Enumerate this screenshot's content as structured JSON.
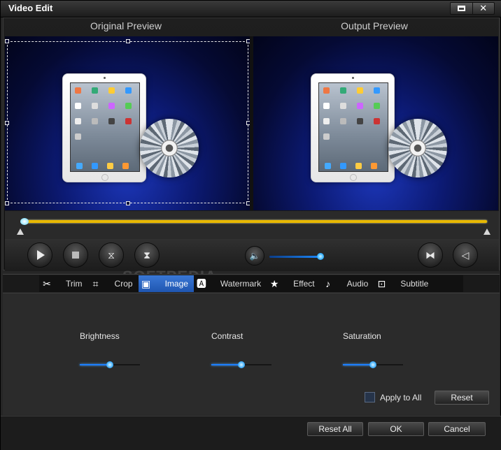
{
  "window": {
    "title": "Video Edit"
  },
  "preview": {
    "original_label": "Original Preview",
    "output_label": "Output Preview"
  },
  "timeline": {
    "position": 0.0
  },
  "volume": {
    "level": 0.9
  },
  "tabs": [
    {
      "label": "Trim",
      "icon": "scissors-icon"
    },
    {
      "label": "Crop",
      "icon": "crop-icon"
    },
    {
      "label": "Image",
      "icon": "image-icon",
      "active": true
    },
    {
      "label": "Watermark",
      "icon": "watermark-icon"
    },
    {
      "label": "Effect",
      "icon": "star-icon"
    },
    {
      "label": "Audio",
      "icon": "music-note-icon"
    },
    {
      "label": "Subtitle",
      "icon": "subtitle-icon"
    }
  ],
  "image": {
    "brightness": {
      "label": "Brightness",
      "value": 0.5
    },
    "contrast": {
      "label": "Contrast",
      "value": 0.5
    },
    "saturation": {
      "label": "Saturation",
      "value": 0.5
    },
    "apply_to_all": {
      "label": "Apply to All",
      "checked": false
    },
    "reset_label": "Reset"
  },
  "footer": {
    "reset_all": "Reset All",
    "ok": "OK",
    "cancel": "Cancel"
  },
  "watermark_text": "SOFTPEDIA",
  "colors": {
    "accent": "#1f56b0",
    "timeline": "#e8b800",
    "slider": "#1c7fff"
  }
}
